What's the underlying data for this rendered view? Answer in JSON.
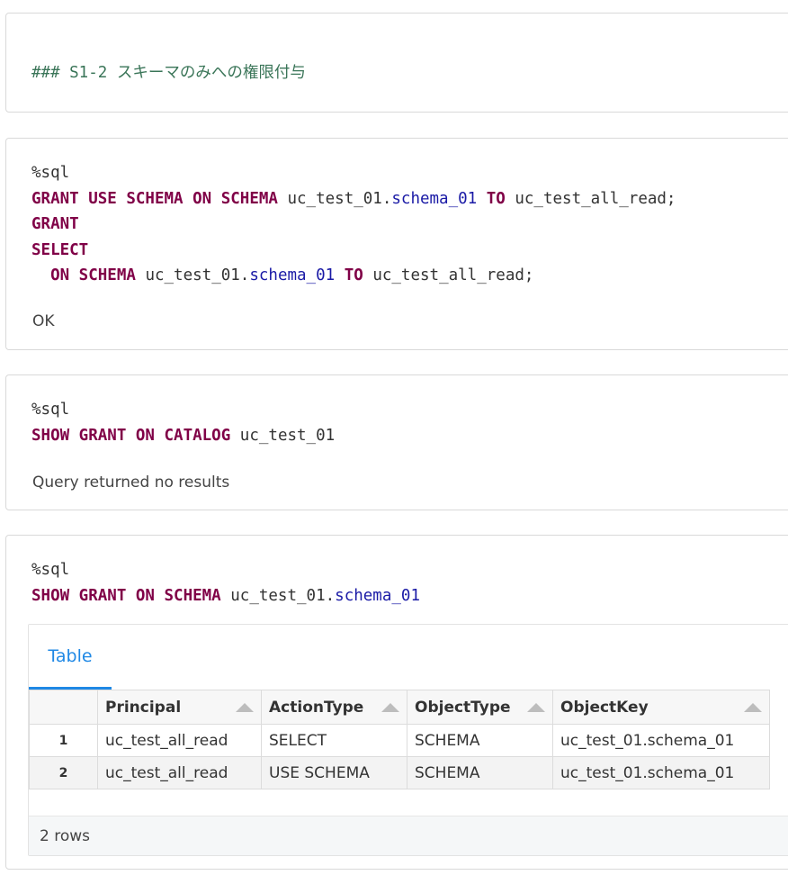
{
  "cell1": {
    "markdown": "### S1-2 スキーマのみへの権限付与"
  },
  "cell2": {
    "magic": "%sql",
    "line1": {
      "k1": "GRANT USE SCHEMA ON SCHEMA",
      "t1": " uc_test_01.",
      "id": "schema_01",
      "k2": " TO",
      "t2": " uc_test_all_read;"
    },
    "line2": {
      "k1": "GRANT"
    },
    "line3": {
      "k1": "SELECT"
    },
    "line4": {
      "indent": "  ",
      "k1": "ON SCHEMA",
      "t1": " uc_test_01.",
      "id": "schema_01",
      "k2": " TO",
      "t2": " uc_test_all_read;"
    },
    "result": "OK"
  },
  "cell3": {
    "magic": "%sql",
    "line1": {
      "k1": "SHOW GRANT ON CATALOG",
      "t1": " uc_test_01"
    },
    "result": "Query returned no results"
  },
  "cell4": {
    "magic": "%sql",
    "line1": {
      "k1": "SHOW GRANT ON SCHEMA",
      "t1": " uc_test_01.",
      "id": "schema_01"
    },
    "tab_label": "Table",
    "columns": [
      "Principal",
      "ActionType",
      "ObjectType",
      "ObjectKey"
    ],
    "rows": [
      {
        "idx": "1",
        "cells": [
          "uc_test_all_read",
          "SELECT",
          "SCHEMA",
          "uc_test_01.schema_01"
        ]
      },
      {
        "idx": "2",
        "cells": [
          "uc_test_all_read",
          "USE SCHEMA",
          "SCHEMA",
          "uc_test_01.schema_01"
        ]
      }
    ],
    "row_count": "2 rows"
  }
}
